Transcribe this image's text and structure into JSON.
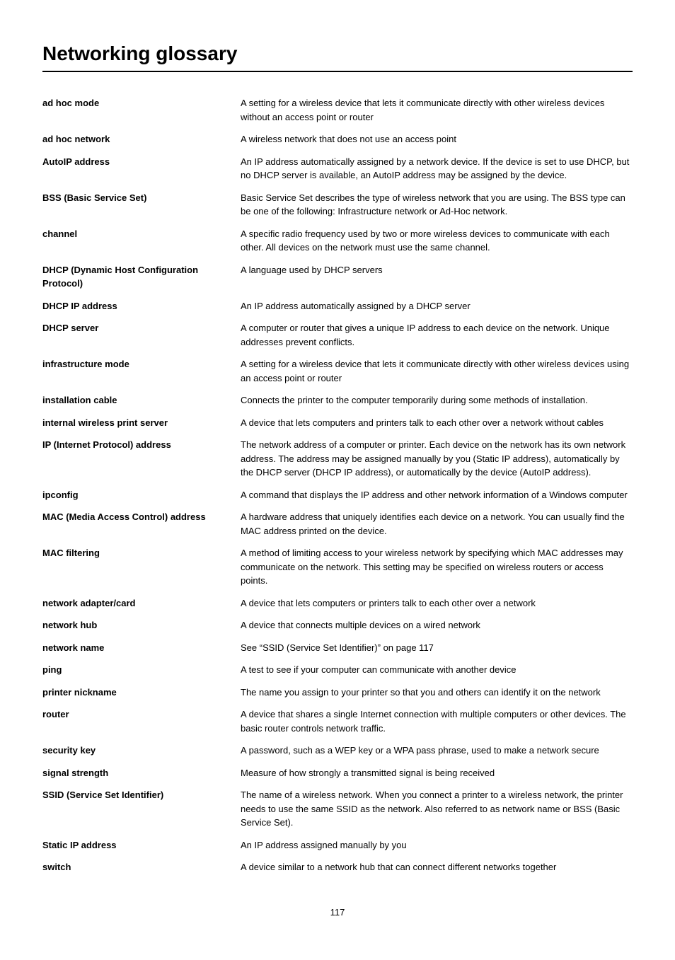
{
  "page": {
    "title": "Networking glossary",
    "page_number": "117"
  },
  "entries": [
    {
      "term": "ad hoc mode",
      "definition": "A setting for a wireless device that lets it communicate directly with other wireless devices without an access point or router"
    },
    {
      "term": "ad hoc network",
      "definition": "A wireless network that does not use an access point"
    },
    {
      "term": "AutoIP address",
      "definition": "An IP address automatically assigned by a network device. If the device is set to use DHCP, but no DHCP server is available, an AutoIP address may be assigned by the device."
    },
    {
      "term": "BSS (Basic Service Set)",
      "definition": "Basic Service Set describes the type of wireless network that you are using. The BSS type can be one of the following: Infrastructure network or Ad-Hoc network."
    },
    {
      "term": "channel",
      "definition": "A specific radio frequency used by two or more wireless devices to communicate with each other. All devices on the network must use the same channel."
    },
    {
      "term": "DHCP (Dynamic Host Configuration Protocol)",
      "definition": "A language used by DHCP servers"
    },
    {
      "term": "DHCP IP address",
      "definition": "An IP address automatically assigned by a DHCP server"
    },
    {
      "term": "DHCP server",
      "definition": "A computer or router that gives a unique IP address to each device on the network. Unique addresses prevent conflicts."
    },
    {
      "term": "infrastructure mode",
      "definition": "A setting for a wireless device that lets it communicate directly with other wireless devices using an access point or router"
    },
    {
      "term": "installation cable",
      "definition": "Connects the printer to the computer temporarily during some methods of installation."
    },
    {
      "term": "internal wireless print server",
      "definition": "A device that lets computers and printers talk to each other over a network without cables"
    },
    {
      "term": "IP (Internet Protocol) address",
      "definition": "The network address of a computer or printer. Each device on the network has its own network address. The address may be assigned manually by you (Static IP address), automatically by the DHCP server (DHCP IP address), or automatically by the device (AutoIP address)."
    },
    {
      "term": "ipconfig",
      "definition": "A command that displays the IP address and other network information of a Windows computer"
    },
    {
      "term": "MAC (Media Access Control) address",
      "definition": "A hardware address that uniquely identifies each device on a network. You can usually find the MAC address printed on the device."
    },
    {
      "term": "MAC filtering",
      "definition": "A method of limiting access to your wireless network by specifying which MAC addresses may communicate on the network. This setting may be specified on wireless routers or access points."
    },
    {
      "term": "network adapter/card",
      "definition": "A device that lets computers or printers talk to each other over a network"
    },
    {
      "term": "network hub",
      "definition": "A device that connects multiple devices on a wired network"
    },
    {
      "term": "network name",
      "definition": "See “SSID (Service Set Identifier)” on page 117"
    },
    {
      "term": "ping",
      "definition": "A test to see if your computer can communicate with another device"
    },
    {
      "term": "printer nickname",
      "definition": "The name you assign to your printer so that you and others can identify it on the network"
    },
    {
      "term": "router",
      "definition": "A device that shares a single Internet connection with multiple computers or other devices. The basic router controls network traffic."
    },
    {
      "term": "security key",
      "definition": "A password, such as a WEP key or a WPA pass phrase, used to make a network secure"
    },
    {
      "term": "signal strength",
      "definition": "Measure of how strongly a transmitted signal is being received"
    },
    {
      "term": "SSID (Service Set Identifier)",
      "definition": "The name of a wireless network. When you connect a printer to a wireless network, the printer needs to use the same SSID as the network. Also referred to as network name or BSS (Basic Service Set)."
    },
    {
      "term": "Static IP address",
      "definition": "An IP address assigned manually by you"
    },
    {
      "term": "switch",
      "definition": "A device similar to a network hub that can connect different networks together"
    }
  ]
}
